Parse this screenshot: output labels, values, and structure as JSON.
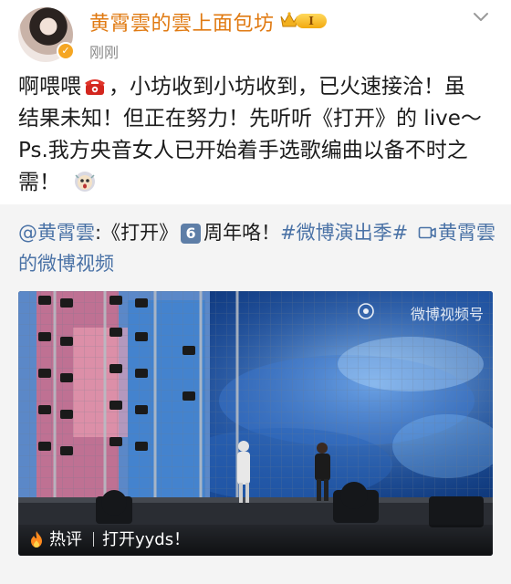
{
  "header": {
    "username": "黄霄雲的雲上面包坊",
    "vip_level": "I",
    "timestamp": "刚刚"
  },
  "post": {
    "lines": [
      {
        "a": "啊喂喂",
        "b": "，小坊收到小坊收到，已火速接洽！虽"
      },
      {
        "text": "结果未知！但正在努力！先听听《打开》的 live～"
      },
      {
        "text": "Ps.我方央音女人已开始着手选歌编曲以备不时之"
      },
      {
        "text": "需！"
      }
    ]
  },
  "shared": {
    "mention": "@黄霄雲",
    "song": ":《打开》",
    "number_badge": "6",
    "after_badge": "周年咯！",
    "hashtag": "#微博演出季#",
    "video_link_a": "黄霄雲",
    "video_link_b": "的微博视频"
  },
  "video": {
    "watermark": "微博视频号",
    "hot_label": "热评",
    "hot_comment": "打开yyds！"
  },
  "colors": {
    "username": "#e07a12",
    "link": "#4a72a6",
    "shared_bg": "#f4f4f4"
  },
  "icons": [
    "verified-badge-icon",
    "vip-crown-icon",
    "chevron-down-icon",
    "telephone-emoji-icon",
    "shocked-emoji-icon",
    "video-link-icon",
    "weibo-eye-icon",
    "fire-icon"
  ]
}
